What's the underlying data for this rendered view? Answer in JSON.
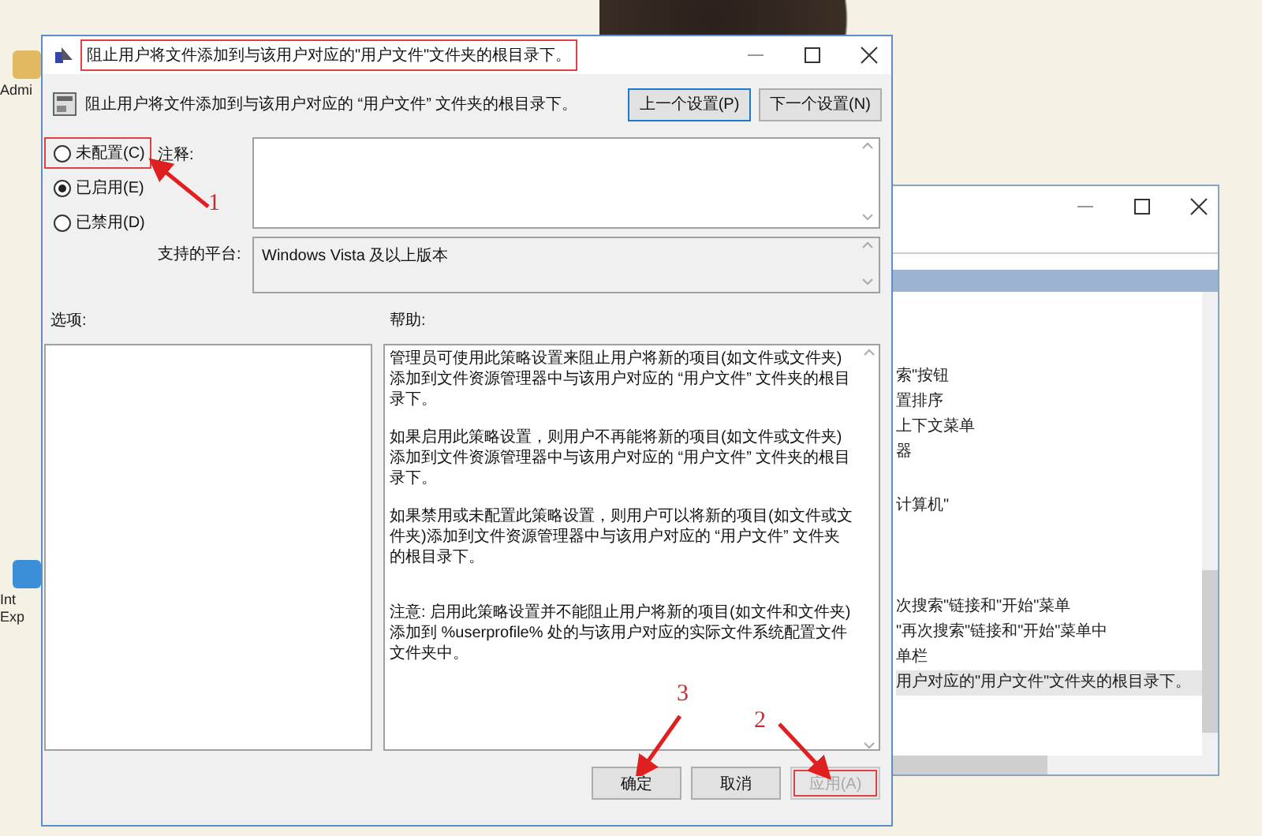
{
  "desktop": {
    "icons": [
      {
        "label": "Admi"
      },
      {
        "label": "Int Exp"
      }
    ]
  },
  "background_window": {
    "items": [
      {
        "text": "索\"按钮",
        "selected": false
      },
      {
        "text": "置排序",
        "selected": false
      },
      {
        "text": "上下文菜单",
        "selected": false
      },
      {
        "text": "器",
        "selected": false
      },
      {
        "text": "计算机\"",
        "selected": false
      },
      {
        "text": "次搜索\"链接和\"开始\"菜单",
        "selected": false
      },
      {
        "text": "\"再次搜索\"链接和\"开始\"菜单中",
        "selected": false
      },
      {
        "text": "单栏",
        "selected": false
      },
      {
        "text": "用户对应的\"用户文件\"文件夹的根目录下。",
        "selected": true
      }
    ]
  },
  "dialog": {
    "title": "阻止用户将文件添加到与该用户对应的\"用户文件\"文件夹的根目录下。",
    "title_highlighted": true,
    "heading": "阻止用户将文件添加到与该用户对应的 “用户文件” 文件夹的根目录下。",
    "nav_buttons": [
      "上一个设置(P)",
      "下一个设置(N)"
    ],
    "options": [
      {
        "label": "未配置(C)",
        "selected": false,
        "highlighted": true
      },
      {
        "label": "已启用(E)",
        "selected": true,
        "highlighted": false
      },
      {
        "label": "已禁用(D)",
        "selected": false,
        "highlighted": false
      }
    ],
    "comment_label": "注释:",
    "platform_label": "支持的平台:",
    "platform_value": "Windows Vista 及以上版本",
    "options_label": "选项:",
    "help_label": "帮助:",
    "help_paragraphs": [
      "管理员可使用此策略设置来阻止用户将新的项目(如文件或文件夹)添加到文件资源管理器中与该用户对应的 “用户文件” 文件夹的根目录下。",
      "如果启用此策略设置，则用户不再能将新的项目(如文件或文件夹)添加到文件资源管理器中与该用户对应的 “用户文件” 文件夹的根目录下。",
      "如果禁用或未配置此策略设置，则用户可以将新的项目(如文件或文件夹)添加到文件资源管理器中与该用户对应的 “用户文件” 文件夹的根目录下。",
      "注意: 启用此策略设置并不能阻止用户将新的项目(如文件和文件夹)添加到 %userprofile% 处的与该用户对应的实际文件系统配置文件文件夹中。"
    ],
    "buttons": [
      {
        "label": "确定",
        "disabled": false,
        "highlighted": false
      },
      {
        "label": "取消",
        "disabled": false,
        "highlighted": false
      },
      {
        "label": "应用(A)",
        "disabled": true,
        "highlighted": true
      }
    ]
  },
  "callouts": [
    {
      "label": "1"
    },
    {
      "label": "3"
    },
    {
      "label": "2"
    }
  ]
}
